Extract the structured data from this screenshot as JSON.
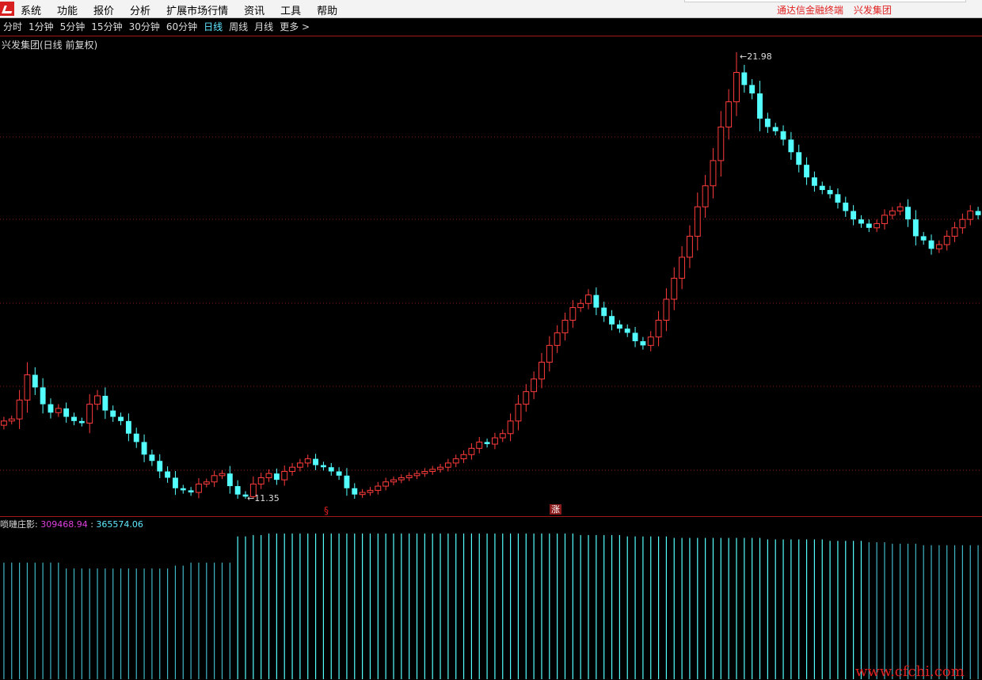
{
  "menubar": {
    "items": [
      "系统",
      "功能",
      "报价",
      "分析",
      "扩展市场行情",
      "资讯",
      "工具",
      "帮助"
    ],
    "right_app_name": "通达信金融终端",
    "right_stock_name": "兴发集团"
  },
  "period_bar": {
    "items": [
      "分时",
      "1分钟",
      "5分钟",
      "15分钟",
      "30分钟",
      "60分钟",
      "日线",
      "周线",
      "月线",
      "更多 >"
    ],
    "active": "日线"
  },
  "chart": {
    "title": "兴发集团(日线 前复权)",
    "high_label": "21.98",
    "low_label": "11.35",
    "signal_s": "§",
    "signal_zhang": "涨",
    "colors": {
      "up": "#ff3c3c",
      "down": "#54ffff",
      "grid": "#8b1a1a",
      "indicator_low": "#40b8c8",
      "indicator_high": "#54ffff"
    }
  },
  "indicator": {
    "name": "唢嗹庄影",
    "value1": "309468.94",
    "value2": "365574.06"
  },
  "watermark": "www.cfchi.com",
  "chart_data": {
    "type": "candlestick",
    "price_high": 21.98,
    "price_low": 11.35,
    "closes": [
      13.2,
      13.25,
      13.7,
      14.3,
      14.0,
      13.6,
      13.4,
      13.5,
      13.3,
      13.2,
      13.15,
      13.6,
      13.8,
      13.45,
      13.3,
      13.2,
      12.9,
      12.7,
      12.4,
      12.25,
      12.0,
      11.85,
      11.6,
      11.55,
      11.5,
      11.7,
      11.75,
      11.9,
      11.95,
      11.65,
      11.45,
      11.4,
      11.7,
      11.85,
      11.95,
      11.8,
      12.0,
      12.1,
      12.2,
      12.3,
      12.15,
      12.1,
      12.0,
      11.9,
      11.6,
      11.45,
      11.5,
      11.55,
      11.65,
      11.75,
      11.8,
      11.85,
      11.9,
      11.95,
      12.0,
      12.05,
      12.1,
      12.2,
      12.3,
      12.4,
      12.55,
      12.7,
      12.65,
      12.8,
      12.9,
      13.2,
      13.6,
      13.9,
      14.2,
      14.6,
      15.0,
      15.3,
      15.6,
      15.9,
      16.0,
      16.2,
      15.9,
      15.7,
      15.5,
      15.4,
      15.3,
      15.1,
      15.0,
      15.2,
      15.6,
      16.1,
      16.6,
      17.1,
      17.6,
      18.3,
      18.8,
      19.4,
      20.2,
      20.8,
      21.5,
      21.2,
      21.0,
      20.4,
      20.2,
      20.1,
      19.9,
      19.6,
      19.3,
      19.0,
      18.8,
      18.7,
      18.6,
      18.4,
      18.2,
      18.0,
      17.9,
      17.8,
      17.9,
      18.1,
      18.2,
      18.3,
      18.0,
      17.6,
      17.5,
      17.3,
      17.4,
      17.6,
      17.8,
      18.0,
      18.2,
      18.1
    ],
    "indicator_values": [
      0.8,
      0.8,
      0.8,
      0.8,
      0.8,
      0.8,
      0.8,
      0.8,
      0.76,
      0.76,
      0.76,
      0.76,
      0.76,
      0.76,
      0.76,
      0.76,
      0.76,
      0.76,
      0.76,
      0.76,
      0.76,
      0.76,
      0.78,
      0.78,
      0.8,
      0.8,
      0.8,
      0.8,
      0.8,
      0.8,
      0.98,
      0.98,
      0.99,
      0.99,
      1.0,
      1.0,
      1.0,
      1.0,
      1.0,
      1.0,
      1.0,
      1.0,
      1.0,
      1.0,
      1.0,
      1.0,
      1.0,
      1.0,
      1.0,
      1.0,
      1.0,
      1.0,
      1.0,
      1.0,
      1.0,
      1.0,
      1.0,
      1.0,
      1.0,
      1.0,
      1.0,
      1.0,
      1.0,
      1.0,
      1.0,
      1.0,
      1.0,
      1.0,
      1.0,
      1.0,
      1.0,
      1.0,
      1.0,
      1.0,
      0.99,
      0.99,
      0.99,
      0.99,
      0.99,
      0.99,
      0.98,
      0.98,
      0.98,
      0.98,
      0.98,
      0.98,
      0.97,
      0.97,
      0.97,
      0.97,
      0.97,
      0.97,
      0.97,
      0.97,
      0.97,
      0.97,
      0.97,
      0.97,
      0.96,
      0.96,
      0.96,
      0.96,
      0.96,
      0.96,
      0.96,
      0.96,
      0.95,
      0.95,
      0.95,
      0.95,
      0.95,
      0.94,
      0.94,
      0.94,
      0.93,
      0.93,
      0.93,
      0.93,
      0.92,
      0.92,
      0.92,
      0.92,
      0.92,
      0.92,
      0.92,
      0.92
    ]
  }
}
